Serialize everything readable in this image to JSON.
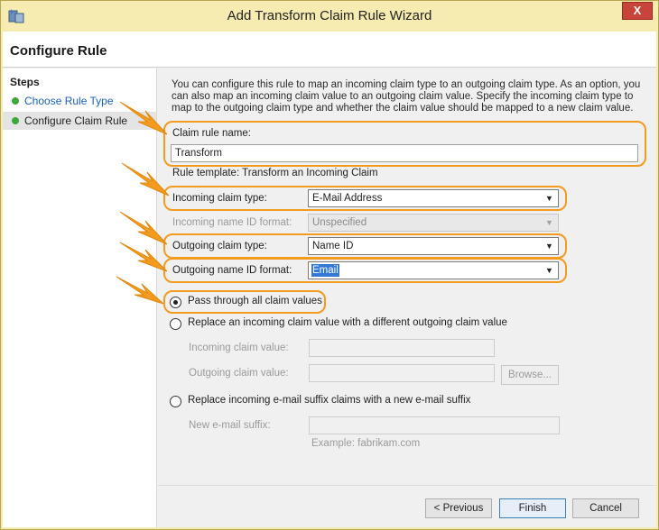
{
  "window": {
    "title": "Add Transform Claim Rule Wizard",
    "close_glyph": "X"
  },
  "header": {
    "title": "Configure Rule"
  },
  "steps": {
    "title": "Steps",
    "items": [
      {
        "label": "Choose Rule Type",
        "state": "link"
      },
      {
        "label": "Configure Claim Rule",
        "state": "current"
      }
    ]
  },
  "main": {
    "description": "You can configure this rule to map an incoming claim type to an outgoing claim type. As an option, you can also map an incoming claim value to an outgoing claim value. Specify the incoming claim type to map to the outgoing claim type and whether the claim value should be mapped to a new claim value.",
    "rule_name_label": "Claim rule name:",
    "rule_name_value": "Transform",
    "rule_template": "Rule template: Transform an Incoming Claim",
    "incoming_type_label": "Incoming claim type:",
    "incoming_type_value": "E-Mail Address",
    "incoming_nameid_label": "Incoming name ID format:",
    "incoming_nameid_value": "Unspecified",
    "outgoing_type_label": "Outgoing claim type:",
    "outgoing_type_value": "Name ID",
    "outgoing_nameid_label": "Outgoing name ID format:",
    "outgoing_nameid_value": "Email",
    "radio_pass": "Pass through all claim values",
    "radio_replace_value": "Replace an incoming claim value with a different outgoing claim value",
    "incoming_value_label": "Incoming claim value:",
    "outgoing_value_label": "Outgoing claim value:",
    "browse_label": "Browse...",
    "radio_replace_suffix": "Replace incoming e-mail suffix claims with a new e-mail suffix",
    "new_suffix_label": "New e-mail suffix:",
    "suffix_example": "Example: fabrikam.com",
    "selected_radio": "pass"
  },
  "footer": {
    "previous": "< Previous",
    "finish": "Finish",
    "cancel": "Cancel"
  },
  "colors": {
    "highlight": "#f39a1f",
    "titlebar": "#f6ebb0",
    "link": "#1a5fb4",
    "step_dot": "#3aa83a"
  }
}
